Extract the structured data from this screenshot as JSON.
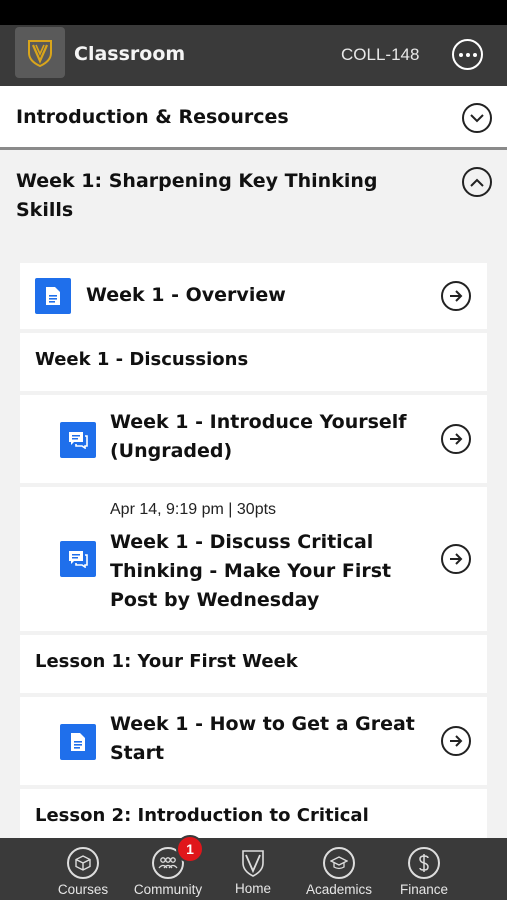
{
  "header": {
    "title": "Classroom",
    "course_code": "COLL-148",
    "logo_icon": "shield-v-logo",
    "menu_icon": "more-horizontal-icon"
  },
  "sections": [
    {
      "title": "Introduction & Resources",
      "expanded": false
    },
    {
      "title_line1": "Week 1: Sharpening Key Thinking",
      "title_line2": "Skills",
      "expanded": true
    }
  ],
  "items": {
    "overview": {
      "title": "Week 1 - Overview"
    },
    "discussions_header": "Week 1 - Discussions",
    "introduce": {
      "title_line1": "Week 1 - Introduce Yourself",
      "title_line2": "(Ungraded)"
    },
    "discuss": {
      "meta": "Apr 14, 9:19 pm | 30pts",
      "title_line1": "Week 1 - Discuss Critical",
      "title_line2": "Thinking - Make Your First",
      "title_line3": "Post by Wednesday"
    },
    "lesson1_header": "Lesson 1: Your First Week",
    "great_start": {
      "title_line1": "Week 1 - How to Get a Great",
      "title_line2": "Start"
    },
    "lesson2_header": "Lesson 2: Introduction to Critical"
  },
  "nav": [
    {
      "label": "Courses",
      "icon": "cube-icon"
    },
    {
      "label": "Community",
      "icon": "people-icon",
      "badge": "1"
    },
    {
      "label": "Home",
      "icon": "shield-home-icon"
    },
    {
      "label": "Academics",
      "icon": "graduation-cap-icon"
    },
    {
      "label": "Finance",
      "icon": "dollar-icon"
    }
  ],
  "colors": {
    "header_bg": "#3a3a3a",
    "accent_blue": "#1f6feb",
    "badge_red": "#e0161b"
  }
}
